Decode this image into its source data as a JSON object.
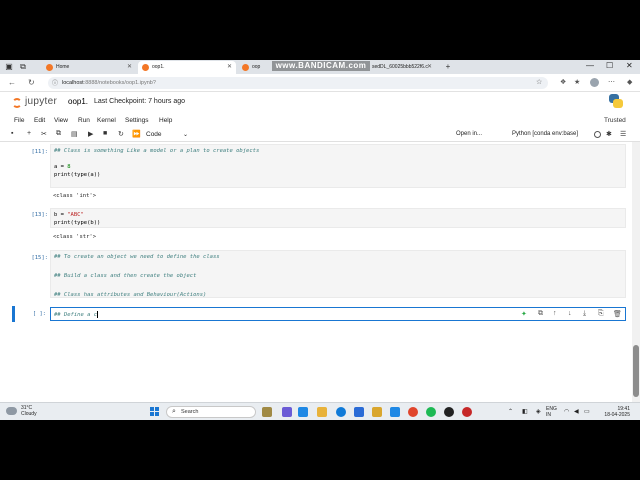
{
  "browser": {
    "tabs": [
      {
        "label": "Home",
        "active": false
      },
      {
        "label": "oop1.",
        "active": true
      },
      {
        "label": "oop",
        "active": false
      },
      {
        "label": "sedDL_60025bbb522f6.c",
        "active": false
      }
    ],
    "watermark": "www.BANDICAM.com",
    "url_host": "localhost",
    "url_path": ":8888/notebooks/oop1.ipynb?"
  },
  "jupyter": {
    "logo_text": "jupyter",
    "notebook_name": "oop1.",
    "checkpoint": "Last Checkpoint: 7 hours ago",
    "menu": [
      "File",
      "Edit",
      "View",
      "Run",
      "Kernel",
      "Settings",
      "Help"
    ],
    "trusted": "Trusted",
    "cell_type": "Code",
    "open_in": "Open in...",
    "kernel": "Python [conda env:base]"
  },
  "cells": {
    "c11": {
      "prompt": "[11]:",
      "line1": "## Class is something Like a model or a plan to create objects",
      "line2_var": "a = ",
      "line2_num": "8",
      "line3": "print(type(a))",
      "output": "<class 'int'>"
    },
    "c13": {
      "prompt": "[13]:",
      "line1_var": "b = ",
      "line1_str": "\"ABC\"",
      "line2": "print(type(b))",
      "output": "<class 'str'>"
    },
    "c15": {
      "prompt": "[15]:",
      "line1": "## To create an object we need to define the class",
      "line2": "## Build a class and then create the object",
      "line3": "## Class has attributes and Behaviour(Actions)"
    },
    "active": {
      "prompt": "[ ]:",
      "text": "## Define a c"
    }
  },
  "taskbar": {
    "temp": "31°C",
    "weather": "Cloudy",
    "search": "Search",
    "lang1": "ENG",
    "lang2": "IN",
    "time": "19:41",
    "date": "18-04-2025"
  }
}
